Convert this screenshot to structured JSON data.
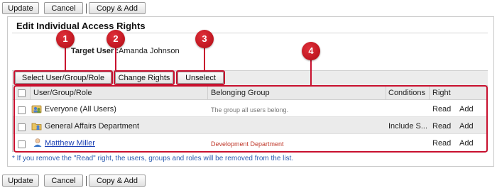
{
  "top_actions": {
    "update": "Update",
    "cancel": "Cancel",
    "copy_add": "Copy & Add"
  },
  "bottom_actions": {
    "update": "Update",
    "cancel": "Cancel",
    "copy_add": "Copy & Add"
  },
  "panel": {
    "title": "Edit Individual Access Rights",
    "target_user_label": "Target User :",
    "target_user_value": "Amanda Johnson"
  },
  "toolbar": {
    "select_label": "Select User/Group/Role",
    "change_label": "Change Rights",
    "unselect_label": "Unselect"
  },
  "table": {
    "headers": {
      "name": "User/Group/Role",
      "group": "Belonging Group",
      "conditions": "Conditions",
      "right": "Right"
    },
    "rows": [
      {
        "name": "Everyone (All Users)",
        "icon": "everyone-icon",
        "group": "The group all users belong.",
        "conditions": "",
        "right": "Read",
        "action": "Add"
      },
      {
        "name": "General Affairs Department",
        "icon": "department-icon",
        "group": "",
        "conditions": "Include S...",
        "right": "Read",
        "action": "Add"
      },
      {
        "name": "Matthew Miller",
        "icon": "user-icon",
        "group": "Development Department",
        "conditions": "",
        "right": "Read",
        "action": "Add"
      }
    ]
  },
  "note": "* If you remove the \"Read\" right, the users, groups and roles will be removed from the list.",
  "callouts": [
    "1",
    "2",
    "3",
    "4"
  ],
  "colors": {
    "callout": "#c8102e",
    "link": "#1a3fb4",
    "group_red": "#c0392b",
    "note_blue": "#2a5bb0"
  }
}
